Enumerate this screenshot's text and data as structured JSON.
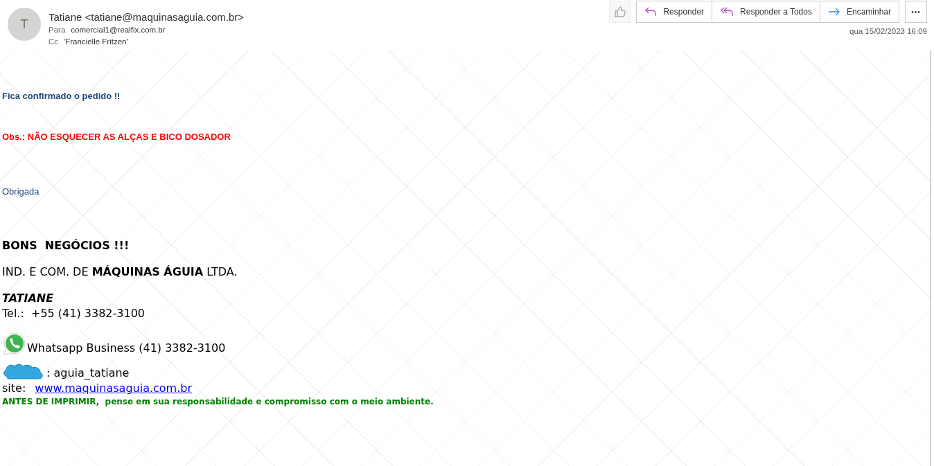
{
  "header": {
    "avatar_initial": "T",
    "sender": "Tatiane <tatiane@maquinasaguia.com.br>",
    "to_label": "Para",
    "to": "comercial1@realfix.com.br",
    "cc_label": "Cc",
    "cc": "'Francielle Fritzen'",
    "date": "qua 15/02/2023 16:09"
  },
  "actions": [
    {
      "kind": "like"
    },
    {
      "kind": "reply",
      "label": "Responder"
    },
    {
      "kind": "reply_all",
      "label": "Responder a Todos"
    },
    {
      "kind": "forward",
      "label": "Encaminhar"
    },
    {
      "kind": "more",
      "label": "•••"
    }
  ],
  "body": [
    {
      "kind": "confirm",
      "text": "Fica confirmado o pedido !!"
    },
    {
      "kind": "alert",
      "text": "Obs.: NÃO ESQUECER AS ALÇAS E BICO DOSADOR"
    },
    {
      "kind": "thanks",
      "text": "Obrigada"
    },
    {
      "kind": "motto",
      "text": "BONS  NEGÓCIOS !!!"
    },
    {
      "kind": "company",
      "text": "IND. E COM. DE **MÁQUINAS ÁGUIA** LTDA."
    },
    {
      "kind": "name",
      "text": "TATIANE"
    },
    {
      "kind": "phone",
      "text": "Tel.:  +55 (41) 3382-3100"
    },
    {
      "kind": "whatsapp",
      "text": "Whatsapp Business (41) 3382-3100"
    },
    {
      "kind": "skype",
      "text": ": aguia_tatiane"
    },
    {
      "kind": "site",
      "label": "site:",
      "link": "www.maquinasaguia.com.br"
    },
    {
      "kind": "eco",
      "text": "ANTES DE IMPRIMIR,  pense em sua responsabilidade e compromisso com o meio ambiente."
    }
  ]
}
